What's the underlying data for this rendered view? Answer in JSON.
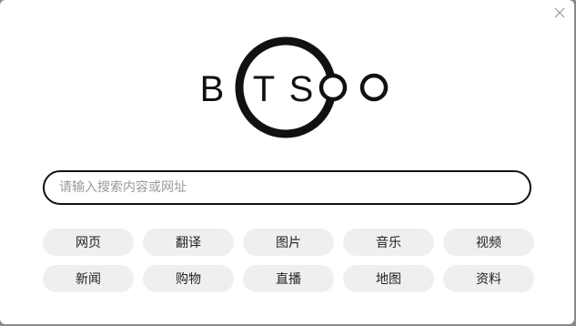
{
  "window": {
    "close_icon": "close-icon"
  },
  "logo": {
    "letters": [
      "B",
      "T",
      "S",
      "O"
    ],
    "text": "BTSOO"
  },
  "search": {
    "value": "",
    "placeholder": "请输入搜索内容或网址"
  },
  "categories": [
    {
      "label": "网页"
    },
    {
      "label": "翻译"
    },
    {
      "label": "图片"
    },
    {
      "label": "音乐"
    },
    {
      "label": "视频"
    },
    {
      "label": "新闻"
    },
    {
      "label": "购物"
    },
    {
      "label": "直播"
    },
    {
      "label": "地图"
    },
    {
      "label": "资料"
    }
  ]
}
